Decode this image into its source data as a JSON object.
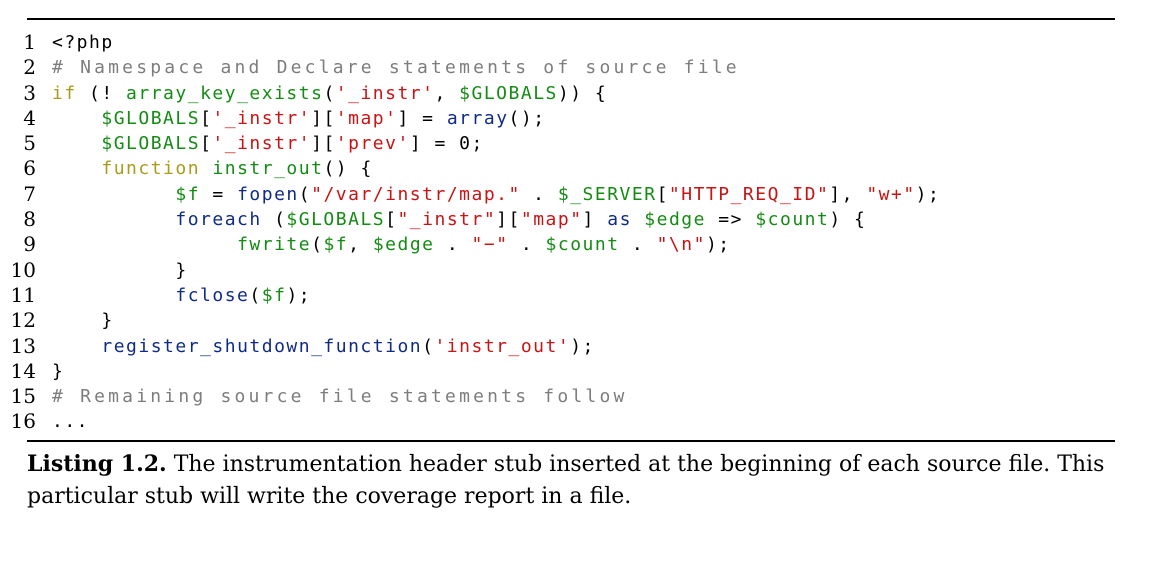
{
  "listing": {
    "lines": [
      {
        "n": "1",
        "indent": 0,
        "tokens": [
          {
            "t": "<?php",
            "c": "plain"
          }
        ]
      },
      {
        "n": "2",
        "indent": 0,
        "tokens": [
          {
            "t": "# Namespace and Declare statements of source file",
            "c": "com"
          }
        ]
      },
      {
        "n": "3",
        "indent": 0,
        "tokens": [
          {
            "t": "if",
            "c": "kw"
          },
          {
            "t": " (! ",
            "c": "plain"
          },
          {
            "t": "array_key_exists",
            "c": "var"
          },
          {
            "t": "(",
            "c": "plain"
          },
          {
            "t": "'_instr'",
            "c": "str"
          },
          {
            "t": ", ",
            "c": "plain"
          },
          {
            "t": "$GLOBALS",
            "c": "var"
          },
          {
            "t": ")) {",
            "c": "plain"
          }
        ]
      },
      {
        "n": "4",
        "indent": 4,
        "tokens": [
          {
            "t": "$GLOBALS",
            "c": "var"
          },
          {
            "t": "[",
            "c": "plain"
          },
          {
            "t": "'_instr'",
            "c": "str"
          },
          {
            "t": "][",
            "c": "plain"
          },
          {
            "t": "'map'",
            "c": "str"
          },
          {
            "t": "] = ",
            "c": "plain"
          },
          {
            "t": "array",
            "c": "fn"
          },
          {
            "t": "();",
            "c": "plain"
          }
        ]
      },
      {
        "n": "5",
        "indent": 4,
        "tokens": [
          {
            "t": "$GLOBALS",
            "c": "var"
          },
          {
            "t": "[",
            "c": "plain"
          },
          {
            "t": "'_instr'",
            "c": "str"
          },
          {
            "t": "][",
            "c": "plain"
          },
          {
            "t": "'prev'",
            "c": "str"
          },
          {
            "t": "] = 0;",
            "c": "plain"
          }
        ]
      },
      {
        "n": "6",
        "indent": 4,
        "tokens": [
          {
            "t": "function",
            "c": "kw"
          },
          {
            "t": " ",
            "c": "plain"
          },
          {
            "t": "instr_out",
            "c": "var"
          },
          {
            "t": "() {",
            "c": "plain"
          }
        ]
      },
      {
        "n": "7",
        "indent": 10,
        "tokens": [
          {
            "t": "$f",
            "c": "var"
          },
          {
            "t": " = ",
            "c": "plain"
          },
          {
            "t": "fopen",
            "c": "fn"
          },
          {
            "t": "(",
            "c": "plain"
          },
          {
            "t": "\"/var/instr/map.\"",
            "c": "str"
          },
          {
            "t": " . ",
            "c": "plain"
          },
          {
            "t": "$_SERVER",
            "c": "var"
          },
          {
            "t": "[",
            "c": "plain"
          },
          {
            "t": "\"HTTP_REQ_ID\"",
            "c": "str"
          },
          {
            "t": "], ",
            "c": "plain"
          },
          {
            "t": "\"w+\"",
            "c": "str"
          },
          {
            "t": ");",
            "c": "plain"
          }
        ]
      },
      {
        "n": "8",
        "indent": 10,
        "tokens": [
          {
            "t": "foreach",
            "c": "fn"
          },
          {
            "t": " (",
            "c": "plain"
          },
          {
            "t": "$GLOBALS",
            "c": "var"
          },
          {
            "t": "[",
            "c": "plain"
          },
          {
            "t": "\"_instr\"",
            "c": "str"
          },
          {
            "t": "][",
            "c": "plain"
          },
          {
            "t": "\"map\"",
            "c": "str"
          },
          {
            "t": "] ",
            "c": "plain"
          },
          {
            "t": "as",
            "c": "fn"
          },
          {
            "t": " ",
            "c": "plain"
          },
          {
            "t": "$edge",
            "c": "var"
          },
          {
            "t": " => ",
            "c": "plain"
          },
          {
            "t": "$count",
            "c": "var"
          },
          {
            "t": ") {",
            "c": "plain"
          }
        ]
      },
      {
        "n": "9",
        "indent": 15,
        "tokens": [
          {
            "t": "fwrite",
            "c": "var"
          },
          {
            "t": "(",
            "c": "plain"
          },
          {
            "t": "$f",
            "c": "var"
          },
          {
            "t": ", ",
            "c": "plain"
          },
          {
            "t": "$edge",
            "c": "var"
          },
          {
            "t": " . ",
            "c": "plain"
          },
          {
            "t": "\"−\"",
            "c": "str"
          },
          {
            "t": " . ",
            "c": "plain"
          },
          {
            "t": "$count",
            "c": "var"
          },
          {
            "t": " . ",
            "c": "plain"
          },
          {
            "t": "\"\\n\"",
            "c": "str"
          },
          {
            "t": ");",
            "c": "plain"
          }
        ]
      },
      {
        "n": "10",
        "indent": 10,
        "tokens": [
          {
            "t": "}",
            "c": "plain"
          }
        ]
      },
      {
        "n": "11",
        "indent": 10,
        "tokens": [
          {
            "t": "fclose",
            "c": "fn"
          },
          {
            "t": "(",
            "c": "plain"
          },
          {
            "t": "$f",
            "c": "var"
          },
          {
            "t": ");",
            "c": "plain"
          }
        ]
      },
      {
        "n": "12",
        "indent": 4,
        "tokens": [
          {
            "t": "}",
            "c": "plain"
          }
        ]
      },
      {
        "n": "13",
        "indent": 4,
        "tokens": [
          {
            "t": "register_shutdown_function",
            "c": "fn"
          },
          {
            "t": "(",
            "c": "plain"
          },
          {
            "t": "'instr_out'",
            "c": "str"
          },
          {
            "t": ");",
            "c": "plain"
          }
        ]
      },
      {
        "n": "14",
        "indent": 0,
        "tokens": [
          {
            "t": "}",
            "c": "plain"
          }
        ]
      },
      {
        "n": "15",
        "indent": 0,
        "tokens": [
          {
            "t": "# Remaining source file statements follow",
            "c": "com"
          }
        ]
      },
      {
        "n": "16",
        "indent": 0,
        "tokens": [
          {
            "t": "...",
            "c": "plain"
          }
        ]
      }
    ]
  },
  "caption": {
    "label": "Listing 1.2.",
    "text": "The instrumentation header stub inserted at the beginning of each source file. This particular stub will write the coverage report in a file."
  },
  "colors": {
    "keyword": "#a99b1c",
    "function": "#0f2b86",
    "variable": "#148c14",
    "string": "#c81414",
    "comment": "#7d7d7d",
    "plain": "#000000"
  }
}
